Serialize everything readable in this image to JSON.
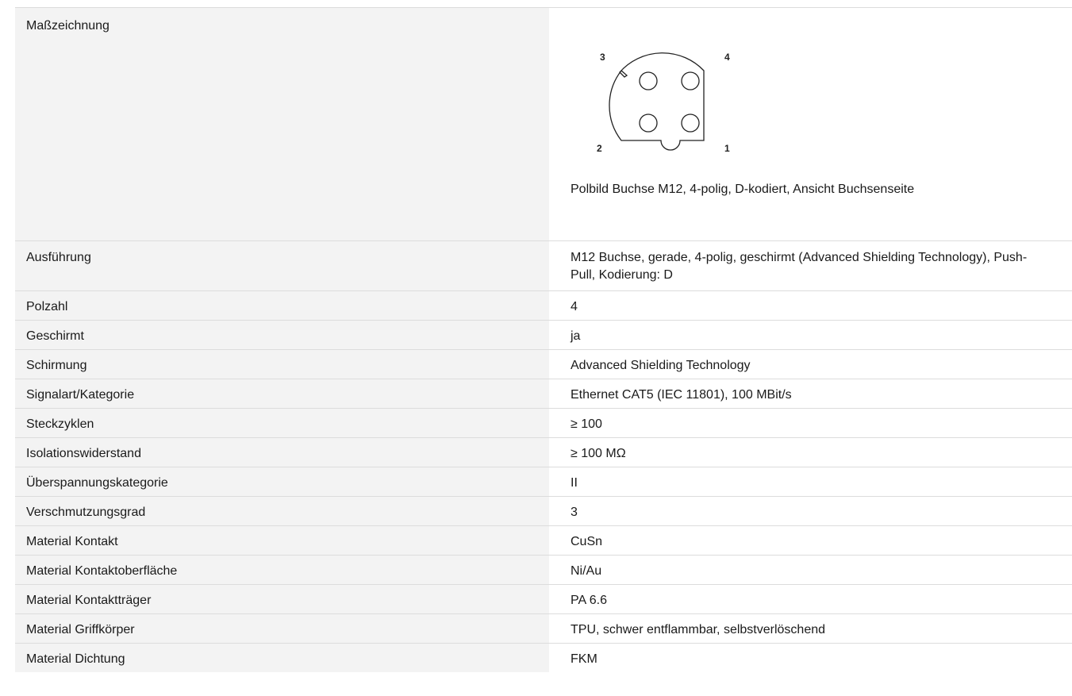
{
  "drawing": {
    "label": "Maßzeichnung",
    "caption": "Polbild Buchse M12, 4-polig, D-kodiert, Ansicht Buchsenseite",
    "pin_labels": {
      "p1": "1",
      "p2": "2",
      "p3": "3",
      "p4": "4"
    }
  },
  "specs": [
    {
      "label": "Ausführung",
      "value": "M12 Buchse, gerade, 4-polig, geschirmt (Advanced Shielding Technology), Push-Pull, Kodierung: D"
    },
    {
      "label": "Polzahl",
      "value": "4"
    },
    {
      "label": "Geschirmt",
      "value": "ja"
    },
    {
      "label": "Schirmung",
      "value": "Advanced Shielding Technology"
    },
    {
      "label": "Signalart/Kategorie",
      "value": "Ethernet CAT5 (IEC 11801), 100 MBit/s"
    },
    {
      "label": "Steckzyklen",
      "value": "≥ 100"
    },
    {
      "label": "Isolationswiderstand",
      "value": "≥ 100 MΩ"
    },
    {
      "label": "Überspannungskategorie",
      "value": "II"
    },
    {
      "label": "Verschmutzungsgrad",
      "value": "3"
    },
    {
      "label": "Material Kontakt",
      "value": "CuSn"
    },
    {
      "label": "Material Kontaktoberfläche",
      "value": "Ni/Au"
    },
    {
      "label": "Material Kontaktträger",
      "value": "PA 6.6"
    },
    {
      "label": "Material Griffkörper",
      "value": "TPU, schwer entflammbar, selbstverlöschend"
    },
    {
      "label": "Material Dichtung",
      "value": "FKM"
    }
  ]
}
